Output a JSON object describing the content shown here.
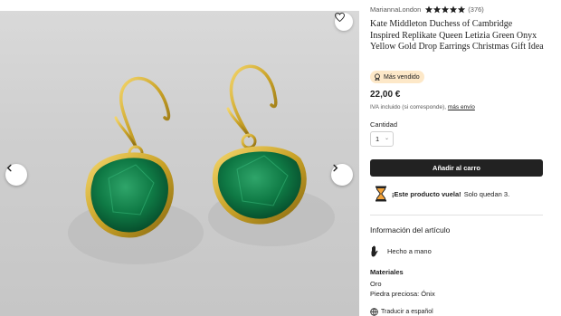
{
  "gallery": {
    "image_subject": "green onyx drop earrings",
    "favorite_icon": "heart-icon",
    "prev_icon": "chevron-left-icon",
    "next_icon": "chevron-right-icon"
  },
  "listing": {
    "shop_name": "MariannaLondon",
    "rating_stars": 5,
    "review_count": "(376)",
    "title": "Kate Middleton Duchess of Cambridge Inspired Replikate Queen Letizia Green Onyx Yellow Gold Drop Earrings Christmas Gift Idea",
    "badge": "Más vendido",
    "price": "22,00 €",
    "tax_note": "IVA incluido (si corresponde),",
    "shipping_link": "más envío"
  },
  "purchase": {
    "quantity_label": "Cantidad",
    "quantity_value": "1",
    "add_to_cart": "Añadir al carro",
    "scarcity_bold": "¡Este producto vuela!",
    "scarcity_text": "Solo quedan 3."
  },
  "details": {
    "section_title": "Información del artículo",
    "handmade": "Hecho a mano",
    "materials_label": "Materiales",
    "material_1": "Oro",
    "material_2": "Piedra preciosa: Ónix",
    "translate": "Traducir a español"
  },
  "colors": {
    "button_dark": "#222222",
    "badge_bg": "#fde8c8",
    "gold": "#c9a227",
    "stone_green": "#0f7a45"
  }
}
